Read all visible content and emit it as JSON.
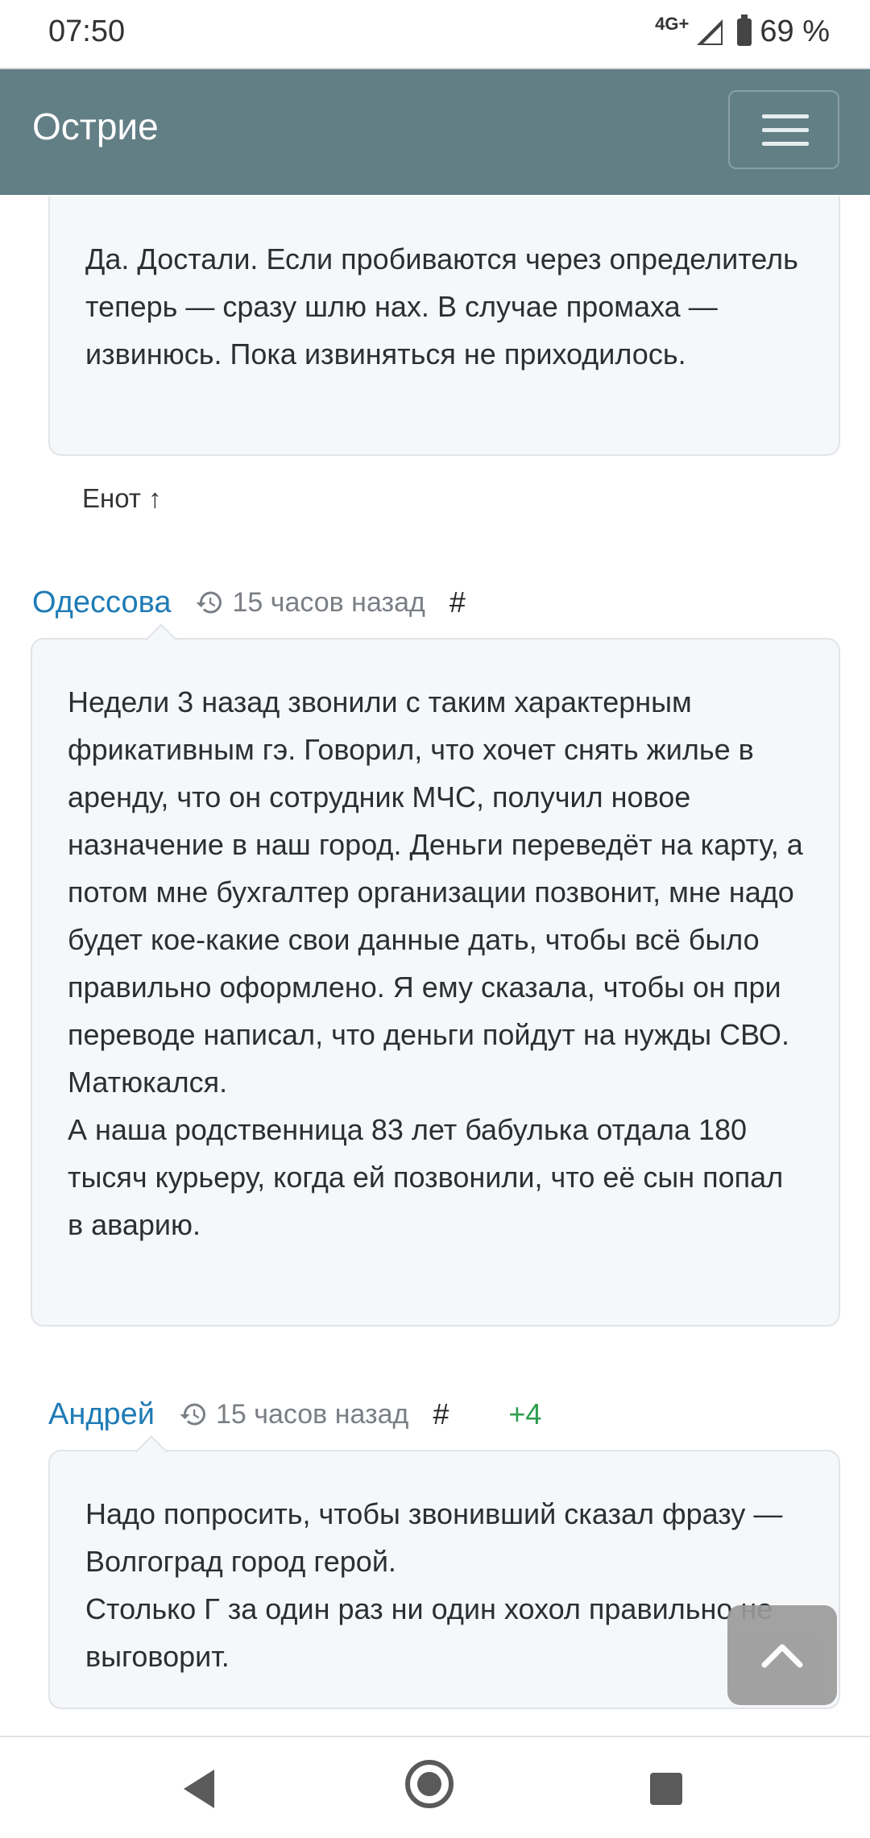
{
  "status_bar": {
    "time": "07:50",
    "network": "4G+",
    "battery": "69 %"
  },
  "navbar": {
    "brand": "Острие",
    "menu_icon": "hamburger-icon"
  },
  "comments": [
    {
      "text": "Да. Достали. Если пробиваются через определитель теперь — сразу шлю нах. В случае промаха — извинюсь. Пока извиняться не приходилось.",
      "reply_link": "Енот ↑"
    },
    {
      "author": "Одессова",
      "time": "15 часов назад",
      "anchor": "#",
      "paragraphs": [
        "Недели 3 назад звонили с таким характерным фрикативным гэ. Говорил, что хочет снять жилье в аренду, что он сотрудник МЧС, получил новое назначение в наш город. Деньги переведёт на карту, а потом мне бухгалтер организации позвонит, мне надо будет кое-какие свои данные дать, чтобы всё было правильно оформлено. Я ему сказала, чтобы он при переводе написал, что деньги пойдут на нужды СВО. Матюкался.",
        "А наша родственница 83 лет бабулька отдала 180 тысяч курьеру, когда ей позвонили, что её сын попал в аварию."
      ]
    },
    {
      "author": "Андрей",
      "time": "15 часов назад",
      "anchor": "#",
      "score": "+4",
      "paragraphs": [
        "Надо попросить, чтобы звонивший сказал фразу — Волгоград город герой.",
        "Столько Г за один раз ни один хохол правильно не выговорит."
      ]
    }
  ],
  "colors": {
    "navbar": "#627f85",
    "author": "#1e7bb5",
    "score": "#2e9e4e",
    "bubble_bg": "#f6f7f9"
  }
}
